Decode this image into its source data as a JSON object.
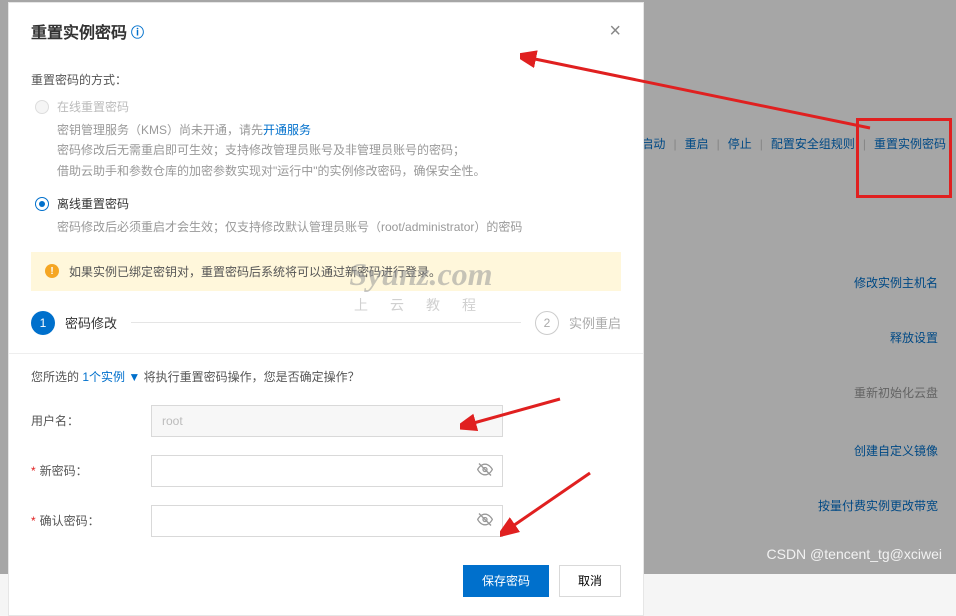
{
  "dialog": {
    "title": "重置实例密码",
    "close_label": "×",
    "method_label": "重置密码的方式：",
    "option_online": {
      "title": "在线重置密码",
      "desc_line1_a": "密钥管理服务（KMS）尚未开通，请先",
      "desc_line1_link": "开通服务",
      "desc_line2": "密码修改后无需重启即可生效；支持修改管理员账号及非管理员账号的密码；",
      "desc_line3": "借助云助手和参数仓库的加密参数实现对\"运行中\"的实例修改密码，确保安全性。"
    },
    "option_offline": {
      "title": "离线重置密码",
      "desc": "密码修改后必须重启才会生效；仅支持修改默认管理员账号（root/administrator）的密码"
    },
    "alert_text": "如果实例已绑定密钥对，重置密码后系统将可以通过新密码进行登录。",
    "step1_label": "密码修改",
    "step2_label": "实例重启",
    "confirm_prefix": "您所选的 ",
    "instance_count": "1个实例",
    "confirm_suffix": " 将执行重置密码操作，您是否确定操作？",
    "username_label": "用户名：",
    "username_value": "root",
    "newpwd_label": "新密码：",
    "confirmpwd_label": "确认密码：",
    "save_btn": "保存密码",
    "cancel_btn": "取消"
  },
  "bg": {
    "action_start": "启动",
    "action_restart": "重启",
    "action_stop": "停止",
    "action_security": "配置安全组规则",
    "action_resetpwd": "重置实例密码",
    "side_hostname": "修改实例主机名",
    "side_release": "释放设置",
    "side_disk": "重新初始化云盘",
    "side_image": "创建自定义镜像",
    "side_bandwidth": "按量付费实例更改带宽"
  },
  "watermark": {
    "domain": "Syunz.com",
    "sub": "上云教程"
  },
  "csdn": "CSDN @tencent_tg@xciwei"
}
